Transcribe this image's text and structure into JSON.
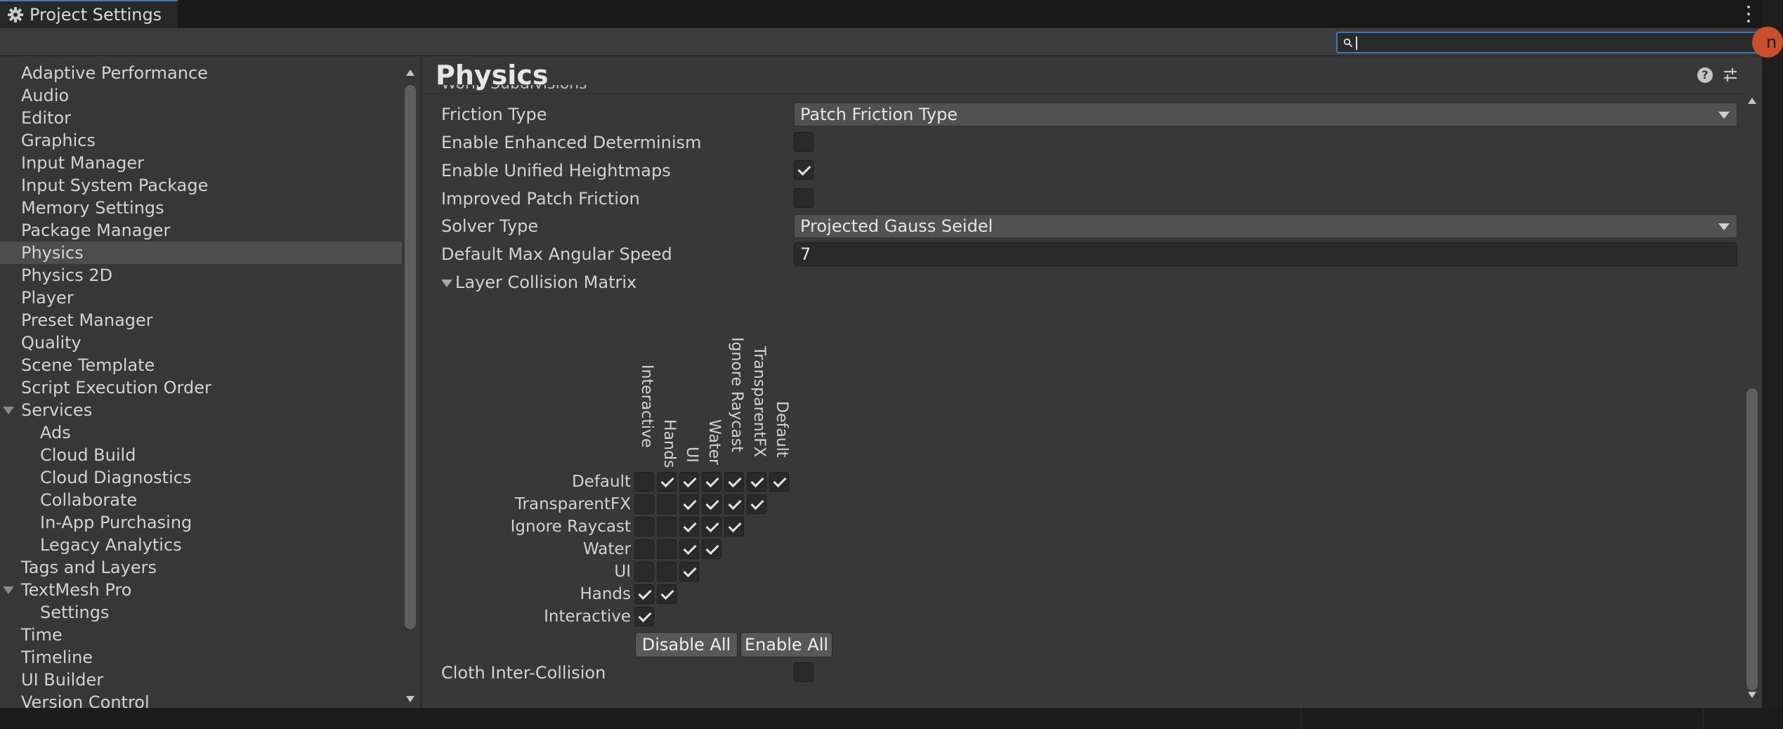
{
  "window": {
    "title": "Project Settings",
    "accent": "#3a79bb"
  },
  "search": {
    "value": "",
    "placeholder": ""
  },
  "sidebar": {
    "items": [
      {
        "label": "Adaptive Performance",
        "level": 0
      },
      {
        "label": "Audio",
        "level": 0
      },
      {
        "label": "Editor",
        "level": 0
      },
      {
        "label": "Graphics",
        "level": 0
      },
      {
        "label": "Input Manager",
        "level": 0
      },
      {
        "label": "Input System Package",
        "level": 0
      },
      {
        "label": "Memory Settings",
        "level": 0
      },
      {
        "label": "Package Manager",
        "level": 0
      },
      {
        "label": "Physics",
        "level": 0,
        "selected": true
      },
      {
        "label": "Physics 2D",
        "level": 0
      },
      {
        "label": "Player",
        "level": 0
      },
      {
        "label": "Preset Manager",
        "level": 0
      },
      {
        "label": "Quality",
        "level": 0
      },
      {
        "label": "Scene Template",
        "level": 0
      },
      {
        "label": "Script Execution Order",
        "level": 0
      },
      {
        "label": "Services",
        "level": 0,
        "expanded": true
      },
      {
        "label": "Ads",
        "level": 1
      },
      {
        "label": "Cloud Build",
        "level": 1
      },
      {
        "label": "Cloud Diagnostics",
        "level": 1
      },
      {
        "label": "Collaborate",
        "level": 1
      },
      {
        "label": "In-App Purchasing",
        "level": 1
      },
      {
        "label": "Legacy Analytics",
        "level": 1
      },
      {
        "label": "Tags and Layers",
        "level": 0
      },
      {
        "label": "TextMesh Pro",
        "level": 0,
        "expanded": true
      },
      {
        "label": "Settings",
        "level": 1
      },
      {
        "label": "Time",
        "level": 0
      },
      {
        "label": "Timeline",
        "level": 0
      },
      {
        "label": "UI Builder",
        "level": 0
      },
      {
        "label": "Version Control",
        "level": 0
      }
    ]
  },
  "main": {
    "title": "Physics",
    "clipped_label": "World Subdivisions",
    "properties": {
      "friction_type": {
        "label": "Friction Type",
        "value": "Patch Friction Type"
      },
      "enhanced_determinism": {
        "label": "Enable Enhanced Determinism",
        "checked": false
      },
      "unified_heightmaps": {
        "label": "Enable Unified Heightmaps",
        "checked": true
      },
      "improved_patch_friction": {
        "label": "Improved Patch Friction",
        "checked": false
      },
      "solver_type": {
        "label": "Solver Type",
        "value": "Projected Gauss Seidel"
      },
      "max_angular_speed": {
        "label": "Default Max Angular Speed",
        "value": "7"
      },
      "cloth_inter_collision": {
        "label": "Cloth Inter-Collision",
        "checked": false
      }
    },
    "matrix": {
      "label": "Layer Collision Matrix",
      "columns": [
        "Interactive",
        "Hands",
        "UI",
        "Water",
        "Ignore Raycast",
        "TransparentFX",
        "Default"
      ],
      "rows": [
        {
          "name": "Default",
          "cells": [
            false,
            true,
            true,
            true,
            true,
            true,
            true
          ]
        },
        {
          "name": "TransparentFX",
          "cells": [
            false,
            false,
            true,
            true,
            true,
            true
          ]
        },
        {
          "name": "Ignore Raycast",
          "cells": [
            false,
            false,
            true,
            true,
            true
          ]
        },
        {
          "name": "Water",
          "cells": [
            false,
            false,
            true,
            true
          ]
        },
        {
          "name": "UI",
          "cells": [
            false,
            false,
            true
          ]
        },
        {
          "name": "Hands",
          "cells": [
            true,
            true
          ]
        },
        {
          "name": "Interactive",
          "cells": [
            true
          ]
        }
      ],
      "disable_all_label": "Disable All",
      "enable_all_label": "Enable All"
    }
  }
}
